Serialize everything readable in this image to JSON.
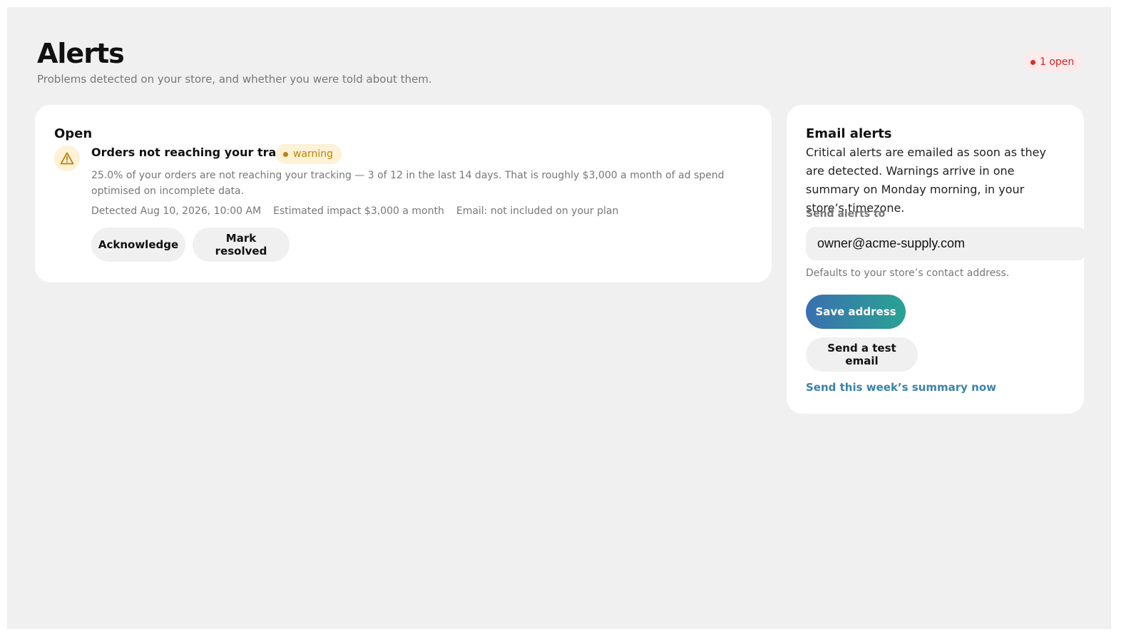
{
  "header": {
    "title": "Alerts",
    "subtitle": "Problems detected on your store, and whether you were told about them.",
    "open_badge": "1 open"
  },
  "open_section": {
    "title": "Open",
    "alerts": [
      {
        "icon": "warning-triangle-icon",
        "title": "Orders not reaching your tracking",
        "severity": "warning",
        "description": "25.0% of your orders are not reaching your tracking — 3 of 12 in the last 14 days. That is roughly $3,000 a month of ad spend optimised on incomplete data.",
        "detected": "Detected Aug 10, 2026, 10:00 AM",
        "impact": "Estimated impact $3,000 a month",
        "email_status": "Email: not included on your plan",
        "acknowledge_label": "Acknowledge",
        "resolve_label": "Mark resolved"
      }
    ]
  },
  "email_alerts": {
    "title": "Email alerts",
    "description": "Critical alerts are emailed as soon as they are detected. Warnings arrive in one summary on Monday morning, in your store’s timezone.",
    "field_label": "Send alerts to",
    "email_value": "owner@acme-supply.com",
    "hint": "Defaults to your store’s contact address.",
    "save_label": "Save address",
    "test_label": "Send a test email",
    "summary_link": "Send this week’s summary now"
  },
  "colors": {
    "background": "#f0f0f0",
    "card": "#ffffff",
    "danger": "#d32f2f",
    "warning": "#b8860b",
    "warning_bg": "#fdf1d6",
    "accent_start": "#3a6fb0",
    "accent_end": "#2aa393",
    "link": "#3b82a8"
  }
}
